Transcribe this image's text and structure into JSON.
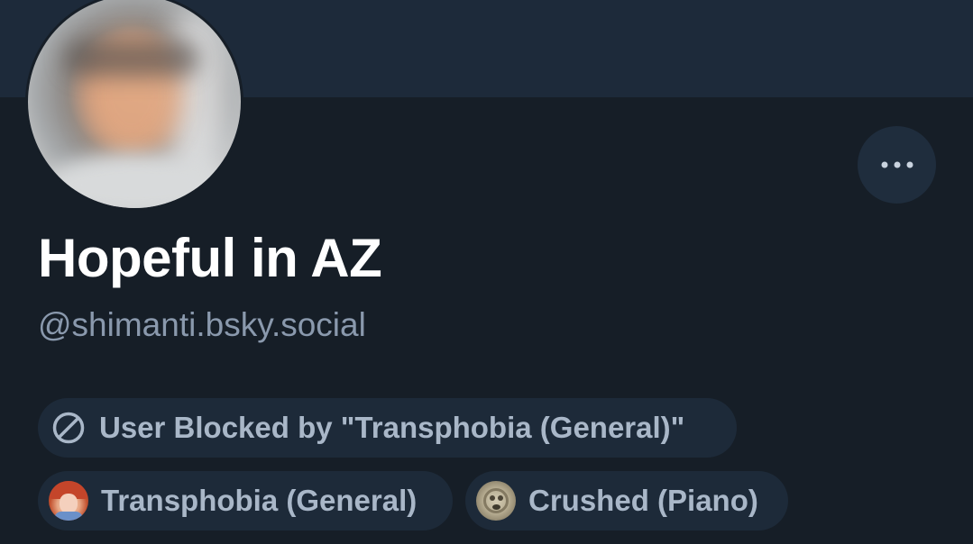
{
  "profile": {
    "display_name": "Hopeful in AZ",
    "handle": "@shimanti.bsky.social"
  },
  "moderation": {
    "blocked_notice": "User Blocked by \"Transphobia (General)\"",
    "labels": [
      {
        "text": "Transphobia (General)",
        "icon": "labeler-avatar-anime"
      },
      {
        "text": "Crushed (Piano)",
        "icon": "labeler-avatar-stone"
      }
    ]
  },
  "actions": {
    "more_icon": "ellipsis-icon"
  },
  "colors": {
    "banner": "#1d2a3a",
    "background": "#161e27",
    "pill": "#1d2a39",
    "pill_text": "#a9b7c8",
    "handle_text": "#8a99ad",
    "name_text": "#ffffff"
  }
}
